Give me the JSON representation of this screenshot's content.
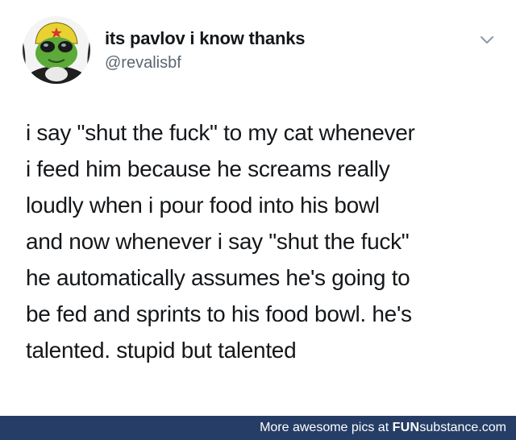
{
  "tweet": {
    "display_name": "its pavlov i know thanks",
    "handle": "@revalisbf",
    "menu_icon": "chevron-down-icon",
    "avatar_icon": "frog-character-avatar",
    "body_lines": [
      "i say \"shut the fuck\" to my cat whenever",
      "i feed him because he screams really",
      "loudly when i pour food into his bowl",
      "and now whenever i say \"shut the fuck\"",
      "he automatically assumes he's going to",
      "be fed and sprints to his food bowl. he's",
      "talented. stupid but talented"
    ]
  },
  "footer": {
    "caption": "More awesome pics at ",
    "brand_strong": "FUN",
    "brand_rest": "substance",
    "brand_tld": ".com",
    "background": "#263d66"
  },
  "colors": {
    "name": "#14171a",
    "handle": "#5b6670",
    "text": "#14171a"
  }
}
